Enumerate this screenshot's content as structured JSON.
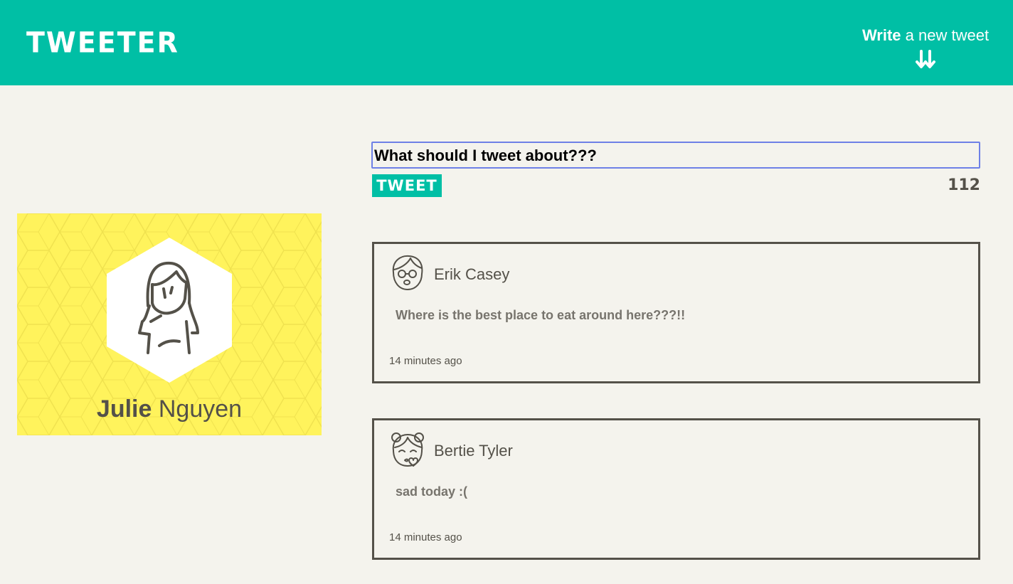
{
  "header": {
    "brand": "TWEETER",
    "compose_strong": "Write",
    "compose_rest": " a new tweet",
    "compose_icon": "double-down-arrow-icon"
  },
  "profile": {
    "first_name": "Julie",
    "last_name": "Nguyen",
    "avatar_icon": "woman-avatar-icon",
    "card_color": "#fff35c"
  },
  "composer": {
    "value": "What should I tweet about???",
    "button_label": "TWEET",
    "counter": "112"
  },
  "tweets": [
    {
      "author": "Erik Casey",
      "avatar_icon": "boy-glasses-avatar-icon",
      "body": "Where is the best place to eat around here???!!",
      "time": "14 minutes ago"
    },
    {
      "author": "Bertie Tyler",
      "avatar_icon": "girl-buns-avatar-icon",
      "body": "sad today :(",
      "time": "14 minutes ago"
    }
  ],
  "colors": {
    "accent": "#00bfa5",
    "background": "#f4f3ed",
    "text": "#545149",
    "input_focus": "#6e80e6"
  }
}
